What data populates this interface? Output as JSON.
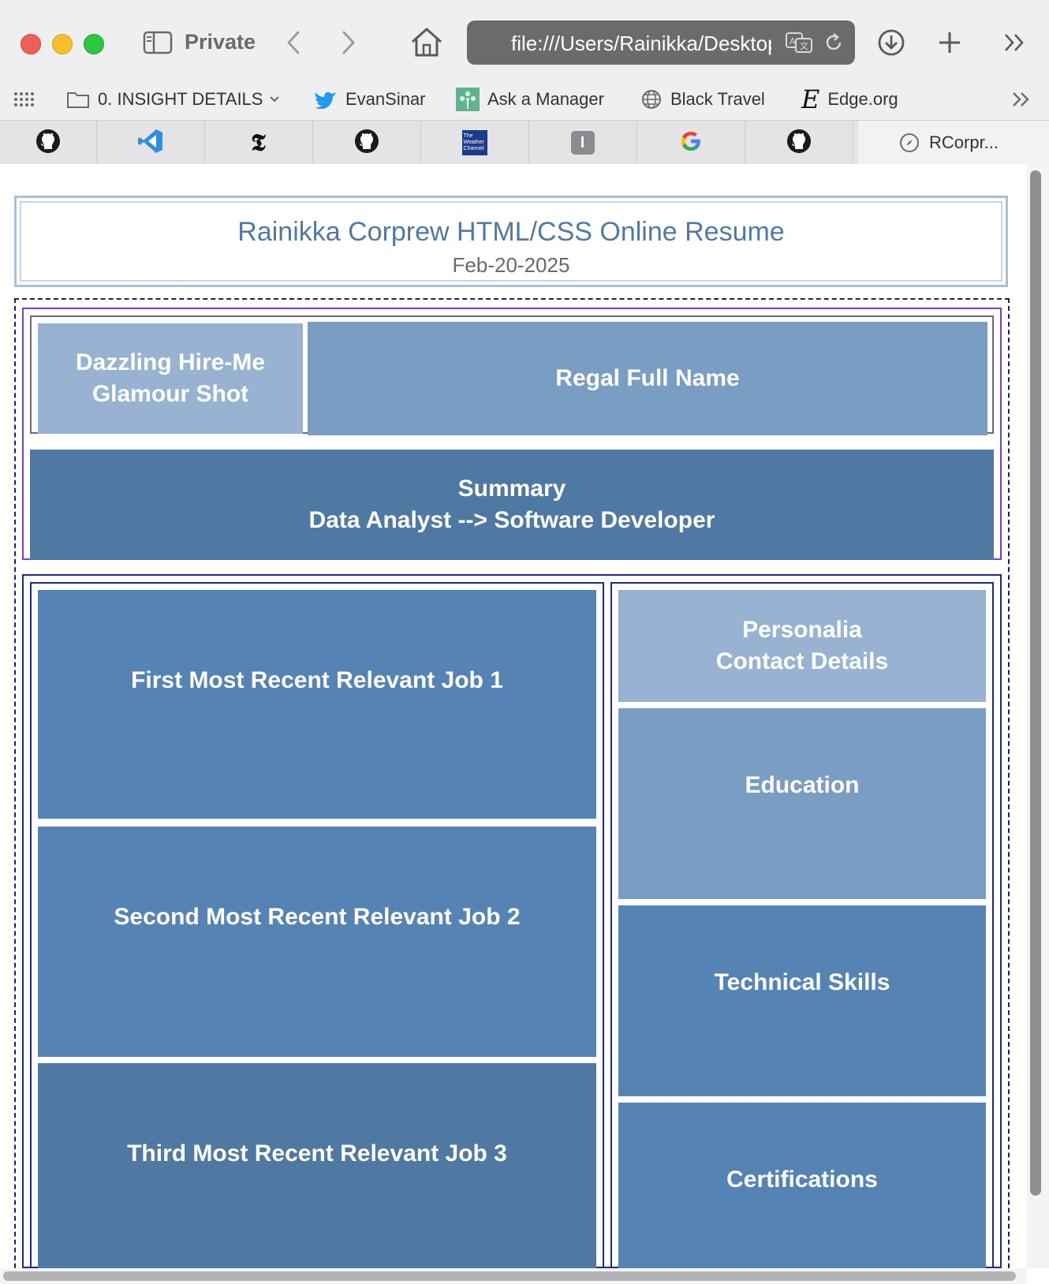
{
  "browser": {
    "mode_label": "Private",
    "address": "file:///Users/Rainikka/Desktop/RCorprew/index.html",
    "bookmarks": [
      {
        "label": "",
        "icon": "apps-grid-icon"
      },
      {
        "label": "0. INSIGHT DETAILS",
        "icon": "folder-icon"
      },
      {
        "label": "EvanSinar",
        "icon": "twitter-icon"
      },
      {
        "label": "Ask a Manager",
        "icon": "askamanager-icon"
      },
      {
        "label": "Black Travel",
        "icon": "globe-icon"
      },
      {
        "label": "Edge.org",
        "icon": "edge-org-icon"
      }
    ],
    "tabs": [
      {
        "icon": "github-icon"
      },
      {
        "icon": "vscode-icon"
      },
      {
        "icon": "nytimes-icon"
      },
      {
        "icon": "github-icon"
      },
      {
        "icon": "weather-channel-icon"
      },
      {
        "icon": "instapaper-icon"
      },
      {
        "icon": "google-icon"
      },
      {
        "icon": "github-icon"
      }
    ],
    "active_tab": {
      "label": "RCorpr...",
      "icon": "compass-icon"
    },
    "weather_channel_text": "The Weather Channel",
    "instapaper_letter": "I",
    "nytimes_letter": "𝕿"
  },
  "page": {
    "header": {
      "title": "Rainikka Corprew HTML/CSS Online Resume",
      "date": "Feb-20-2025"
    },
    "glamour_shot": {
      "line1": "Dazzling Hire-Me",
      "line2": "Glamour Shot"
    },
    "full_name": "Regal Full Name",
    "summary": {
      "line1": "Summary",
      "line2": "Data Analyst --> Software Developer"
    },
    "jobs": [
      "First Most Recent Relevant Job 1",
      "Second Most Recent Relevant Job 2",
      "Third Most Recent Relevant Job 3"
    ],
    "sidebar": {
      "personalia": {
        "line1": "Personalia",
        "line2": "Contact Details"
      },
      "education": "Education",
      "technical_skills": "Technical Skills",
      "certifications": "Certifications"
    }
  },
  "colors": {
    "title": "#5279a6",
    "block_light": "#97b3d1",
    "block_mid": "#7a9dc3",
    "block_dark": "#4f78a2",
    "block_blue": "#5583b3"
  }
}
